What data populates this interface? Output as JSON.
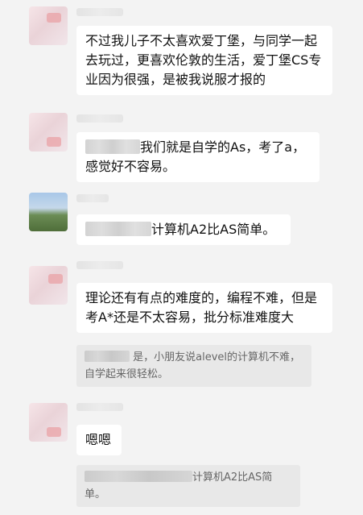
{
  "messages": [
    {
      "text": "不过我儿子不太喜欢爱丁堡，与同学一起去玩过，更喜欢伦敦的生活，爱丁堡CS专业因为很强，是被我说服才报的"
    },
    {
      "text": "我们就是自学的As，考了a，感觉好不容易。"
    },
    {
      "text": "计算机A2比AS简单。"
    },
    {
      "text": "理论还有有点的难度的，编程不难，但是考A*还是不太容易，批分标准难度大",
      "quote": "是，小朋友说alevel的计算机不难，自学起来很轻松。"
    },
    {
      "text": "嗯嗯",
      "quote": "计算机A2比AS简单。"
    }
  ]
}
